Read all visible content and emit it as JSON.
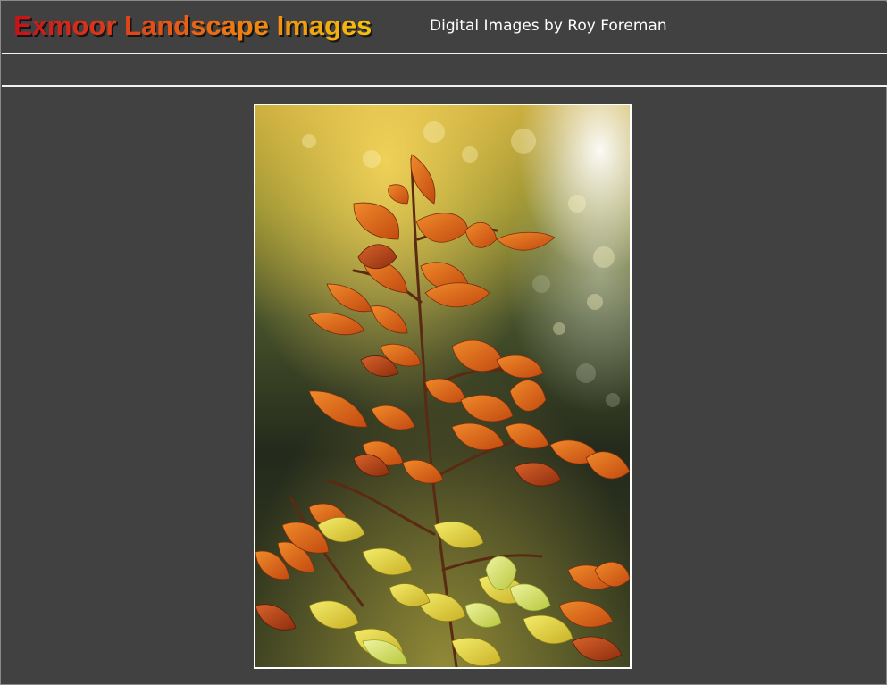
{
  "header": {
    "site_title": "Exmoor Landscape Images",
    "subtitle": "Digital Images by Roy Foreman"
  },
  "main": {
    "photo": {
      "subject": "autumn-beech-leaves-photo"
    }
  },
  "colors": {
    "page_background": "#414141",
    "rule": "#f2f2f2",
    "title_gradient_start": "#c4121a",
    "title_gradient_end": "#f5c20d",
    "subtitle_text": "#ffffff"
  }
}
